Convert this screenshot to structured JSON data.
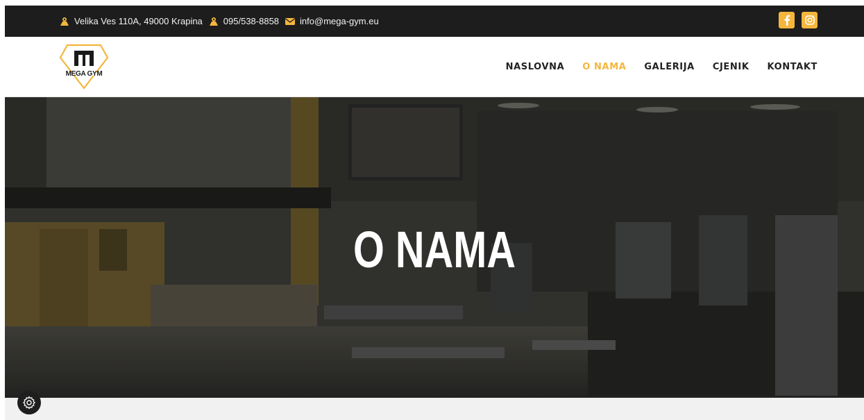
{
  "topbar": {
    "address": "Velika Ves 110A, 49000 Krapina",
    "phone": "095/538-8858",
    "email": "info@mega-gym.eu",
    "icons": [
      "map-marker-icon",
      "phone-icon",
      "envelope-icon"
    ],
    "social": [
      "facebook-icon",
      "instagram-icon"
    ]
  },
  "logo": {
    "text": "MEGA GYM"
  },
  "nav": {
    "items": [
      {
        "label": "NASLOVNA",
        "active": false
      },
      {
        "label": "O NAMA",
        "active": true
      },
      {
        "label": "GALERIJA",
        "active": false
      },
      {
        "label": "CJENIK",
        "active": false
      },
      {
        "label": "KONTAKT",
        "active": false
      }
    ]
  },
  "hero": {
    "title": "O NAMA"
  },
  "colors": {
    "accent": "#f4b63d",
    "topbar": "#1d1d1d",
    "nav_text": "#222222"
  },
  "widgets": {
    "accessibility": "accessibility-icon",
    "settings": "gear-icon"
  }
}
